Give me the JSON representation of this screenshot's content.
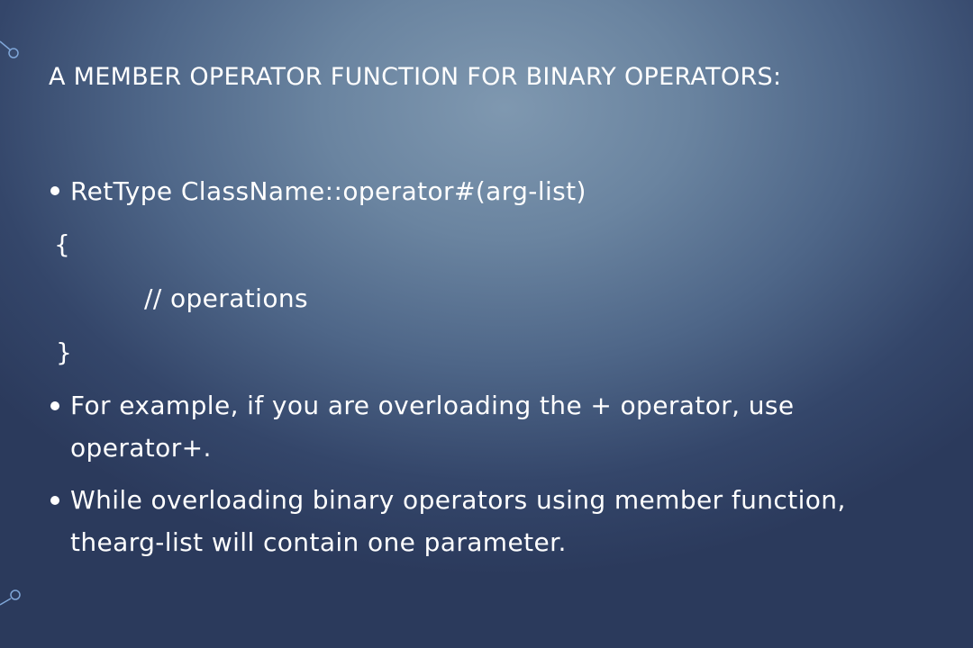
{
  "slide": {
    "title": "A MEMBER OPERATOR FUNCTION FOR BINARY OPERATORS:",
    "code": {
      "signature": "RetType ClassName::operator#(arg-list)",
      "open_brace": "{",
      "body": "// operations",
      "close_brace": "}"
    },
    "bullet2": {
      "line1": "For example, if you are overloading the + operator, use",
      "line2": "operator+."
    },
    "bullet3": {
      "line1": "While overloading binary operators using member function,",
      "line2": "thearg-list will contain one parameter."
    }
  },
  "colors": {
    "text": "#ffffff",
    "deco_stroke": "#7fa6d8"
  }
}
